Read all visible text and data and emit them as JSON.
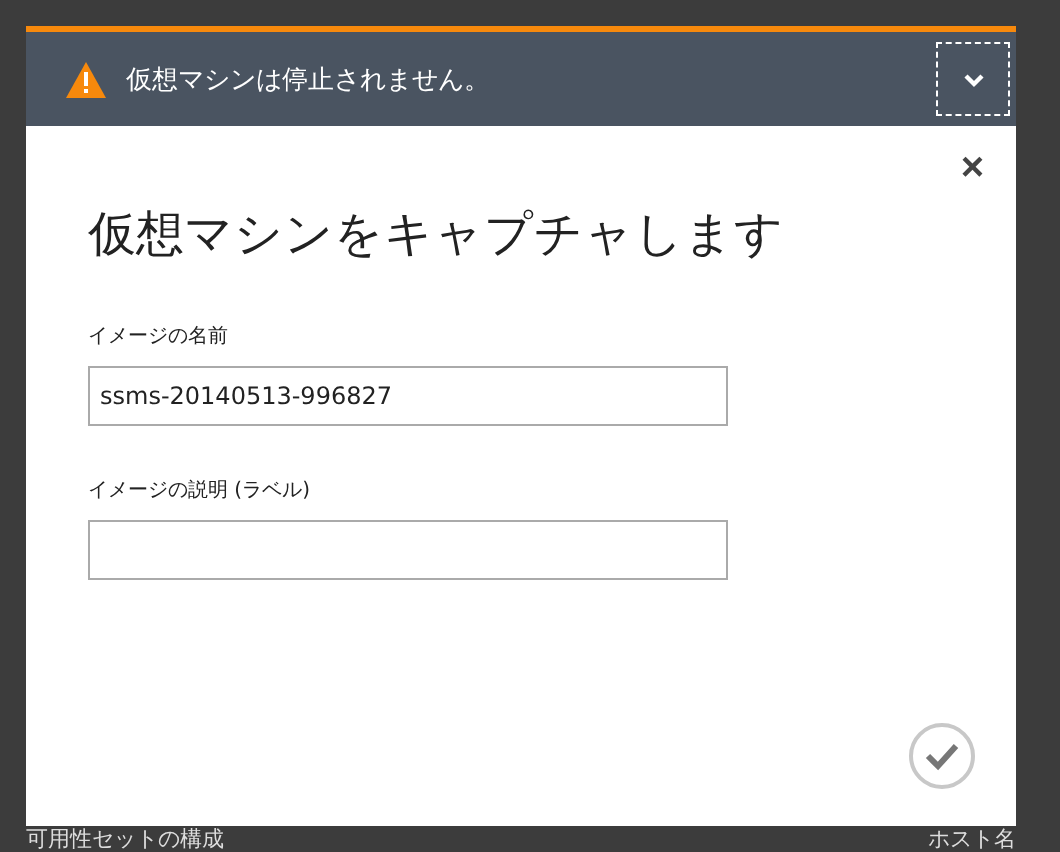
{
  "notification": {
    "message": "仮想マシンは停止されません。",
    "expanded": false
  },
  "dialog": {
    "close": "×",
    "title": "仮想マシンをキャプチャします",
    "fields": [
      {
        "label": "イメージの名前",
        "value": "ssms-20140513-996827"
      },
      {
        "label": "イメージの説明 (ラベル)"
      }
    ]
  },
  "background": {
    "left_text": "可用性セットの構成",
    "right_text": "ホスト名"
  }
}
